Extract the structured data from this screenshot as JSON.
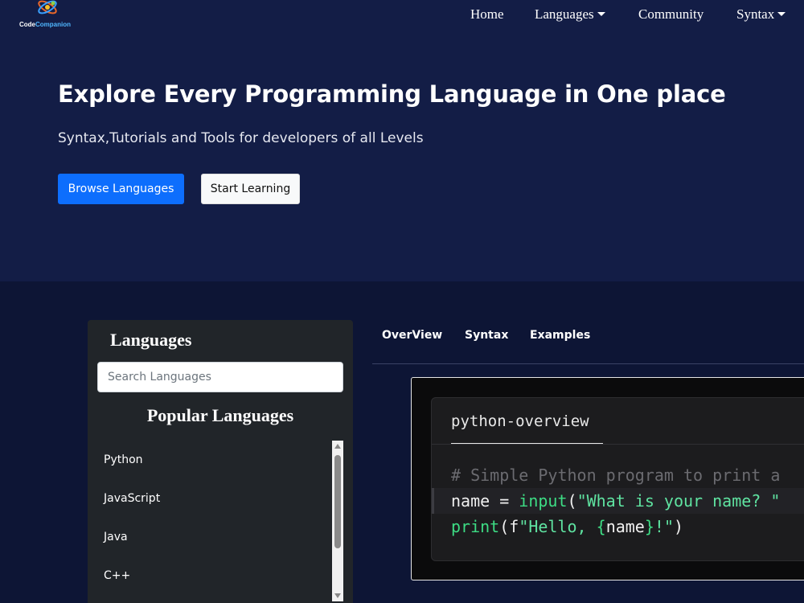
{
  "brand": {
    "name_part1": "Code",
    "name_part2": "Companion"
  },
  "nav": {
    "items": [
      {
        "label": "Home"
      },
      {
        "label": "Languages"
      },
      {
        "label": "Community"
      },
      {
        "label": "Syntax"
      }
    ]
  },
  "hero": {
    "title": "Explore Every Programming Language in One place",
    "subtitle": "Syntax,Tutorials and Tools for developers of all Levels",
    "primary_button": "Browse Languages",
    "secondary_button": "Start Learning"
  },
  "sidebar": {
    "title": "Languages",
    "search_placeholder": "Search Languages",
    "popular_title": "Popular Languages",
    "languages": [
      "Python",
      "JavaScript",
      "Java",
      "C++"
    ]
  },
  "tabs": [
    "OverView",
    "Syntax",
    "Examples"
  ],
  "code": {
    "tab_label": "python-overview",
    "comment": "# Simple Python program to print a",
    "line2_var": "name",
    "line2_op": " = ",
    "line2_fn": "input",
    "line2_open": "(",
    "line2_str": "\"What is your name? \"",
    "line3_fn": "print",
    "line3_open": "(f",
    "line3_str_a": "\"Hello, ",
    "line3_brace_open": "{",
    "line3_var": "name",
    "line3_brace_close": "}",
    "line3_str_b": "!\"",
    "line3_close": ")"
  },
  "colors": {
    "nav_bg": "#131d46",
    "main_bg": "#0d1535",
    "primary": "#0d6efd",
    "sidebar_bg": "#212529",
    "code_keyword": "#3ddc84"
  }
}
